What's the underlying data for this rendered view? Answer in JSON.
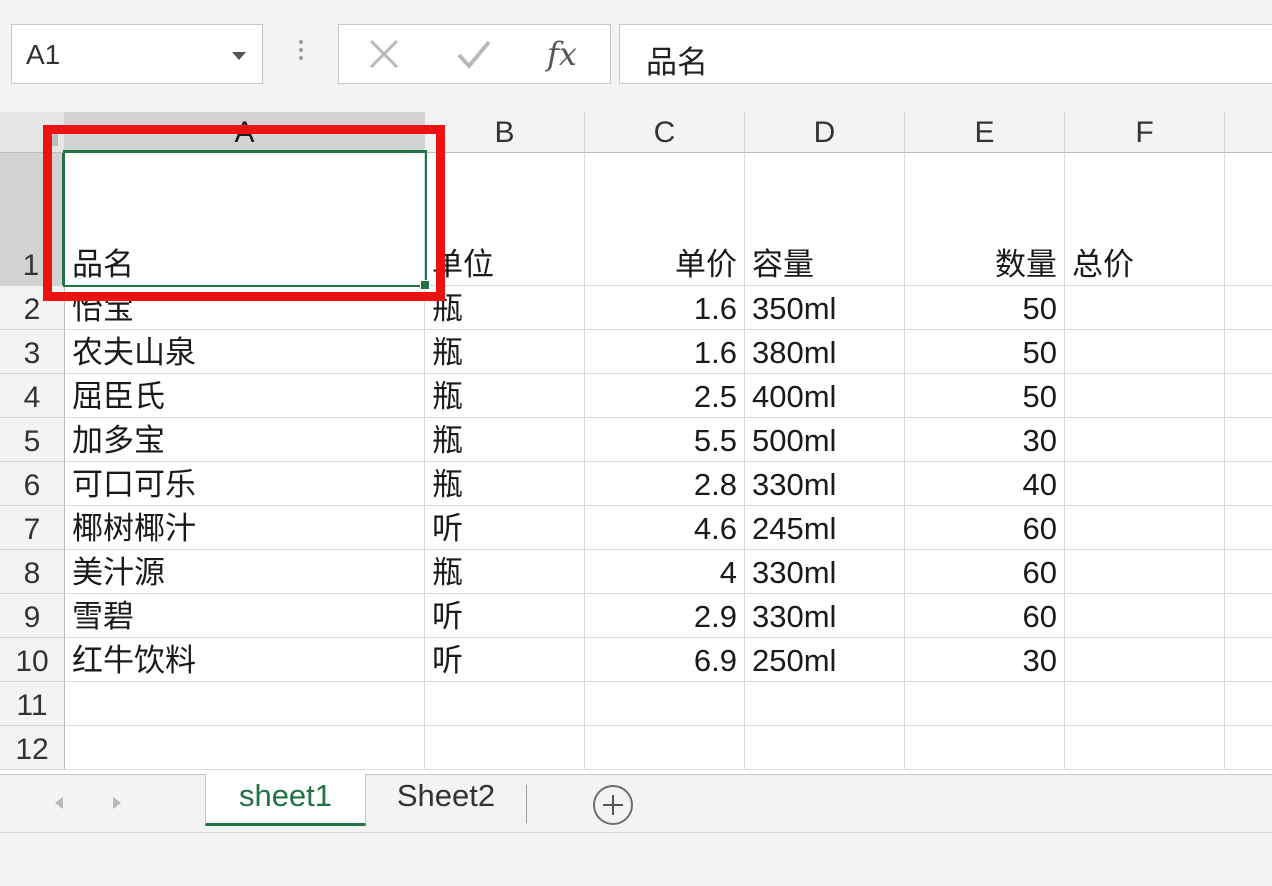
{
  "formula_bar": {
    "name_box": "A1",
    "fx_label": "fx",
    "content": "品名"
  },
  "columns": [
    "A",
    "B",
    "C",
    "D",
    "E",
    "F"
  ],
  "row_numbers": [
    "1",
    "2",
    "3",
    "4",
    "5",
    "6",
    "7",
    "8",
    "9",
    "10",
    "11",
    "12"
  ],
  "rows": [
    [
      "品名",
      "单位",
      "单价",
      "容量",
      "数量",
      "总价"
    ],
    [
      "怡宝",
      "瓶",
      "1.6",
      "350ml",
      "50",
      ""
    ],
    [
      "农夫山泉",
      "瓶",
      "1.6",
      "380ml",
      "50",
      ""
    ],
    [
      "屈臣氏",
      "瓶",
      "2.5",
      "400ml",
      "50",
      ""
    ],
    [
      "加多宝",
      "瓶",
      "5.5",
      "500ml",
      "30",
      ""
    ],
    [
      "可口可乐",
      "瓶",
      "2.8",
      "330ml",
      "40",
      ""
    ],
    [
      "椰树椰汁",
      "听",
      "4.6",
      "245ml",
      "60",
      ""
    ],
    [
      "美汁源",
      "瓶",
      "4",
      "330ml",
      "60",
      ""
    ],
    [
      "雪碧",
      "听",
      "2.9",
      "330ml",
      "60",
      ""
    ],
    [
      "红牛饮料",
      "听",
      "6.9",
      "250ml",
      "30",
      ""
    ],
    [
      "",
      "",
      "",
      "",
      "",
      ""
    ],
    [
      "",
      "",
      "",
      "",
      "",
      ""
    ]
  ],
  "sheets": [
    "sheet1",
    "Sheet2"
  ],
  "active_sheet": "sheet1",
  "colors": {
    "accent": "#217346",
    "highlight": "#ee1111"
  }
}
